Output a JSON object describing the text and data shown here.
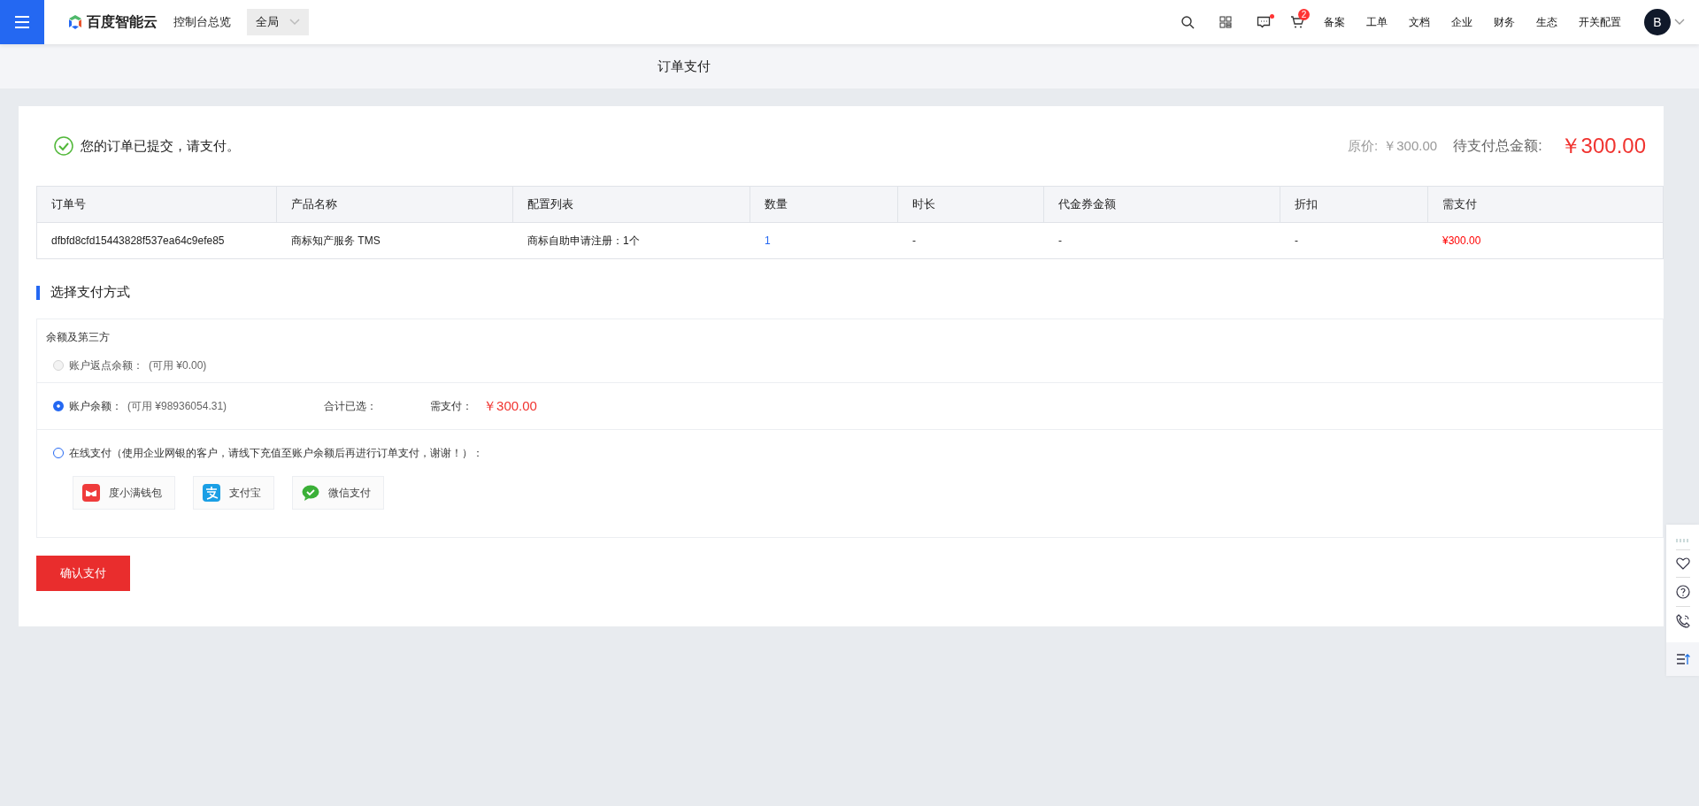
{
  "topbar": {
    "logo_text": "百度智能云",
    "console_link": "控制台总览",
    "region_select": "全局",
    "message_unread": true,
    "cart_badge": "2",
    "nav_links": [
      "备案",
      "工单",
      "文档",
      "企业",
      "财务",
      "生态",
      "开关配置"
    ],
    "avatar_letter": "B"
  },
  "page_title": "订单支付",
  "order": {
    "status_text": "您的订单已提交，请支付。",
    "original_label": "原价:",
    "original_price": "￥300.00",
    "total_label": "待支付总金额:",
    "total_amount": "￥300.00"
  },
  "table": {
    "columns": [
      "订单号",
      "产品名称",
      "配置列表",
      "数量",
      "时长",
      "代金券金额",
      "折扣",
      "需支付"
    ],
    "rows": [
      [
        {
          "text": "dfbfd8cfd15443828f537ea64c9efe85",
          "kind": "plain"
        },
        {
          "text": "商标知产服务 TMS",
          "kind": "plain"
        },
        {
          "text": "商标自助申请注册：1个",
          "kind": "plain"
        },
        {
          "text": "1",
          "kind": "link"
        },
        {
          "text": "-",
          "kind": "plain"
        },
        {
          "text": "-",
          "kind": "plain"
        },
        {
          "text": "-",
          "kind": "plain"
        },
        {
          "text": "¥300.00",
          "kind": "price"
        }
      ]
    ]
  },
  "payment": {
    "section_title": "选择支付方式",
    "group_title": "余额及第三方",
    "options": [
      {
        "kind": "balance",
        "label": "账户返点余额：",
        "available": "(可用 ¥0.00)",
        "selected": false,
        "disabled": true
      },
      {
        "kind": "balance",
        "label": "账户余额：",
        "available": "(可用 ¥98936054.31)",
        "selected": true,
        "disabled": false,
        "summary_label": "合计已选：",
        "due_label": "需支付：",
        "due_amount": "￥300.00"
      },
      {
        "kind": "online",
        "label": "在线支付（使用企业网银的客户，请线下充值至账户余额后再进行订单支付，谢谢！）：",
        "selected": false,
        "disabled": false,
        "methods": [
          {
            "kind": "wallet",
            "label": "度小满钱包"
          },
          {
            "kind": "alipay",
            "label": "支付宝"
          },
          {
            "kind": "wechat",
            "label": "微信支付"
          }
        ]
      }
    ]
  },
  "confirm_button": "确认支付"
}
